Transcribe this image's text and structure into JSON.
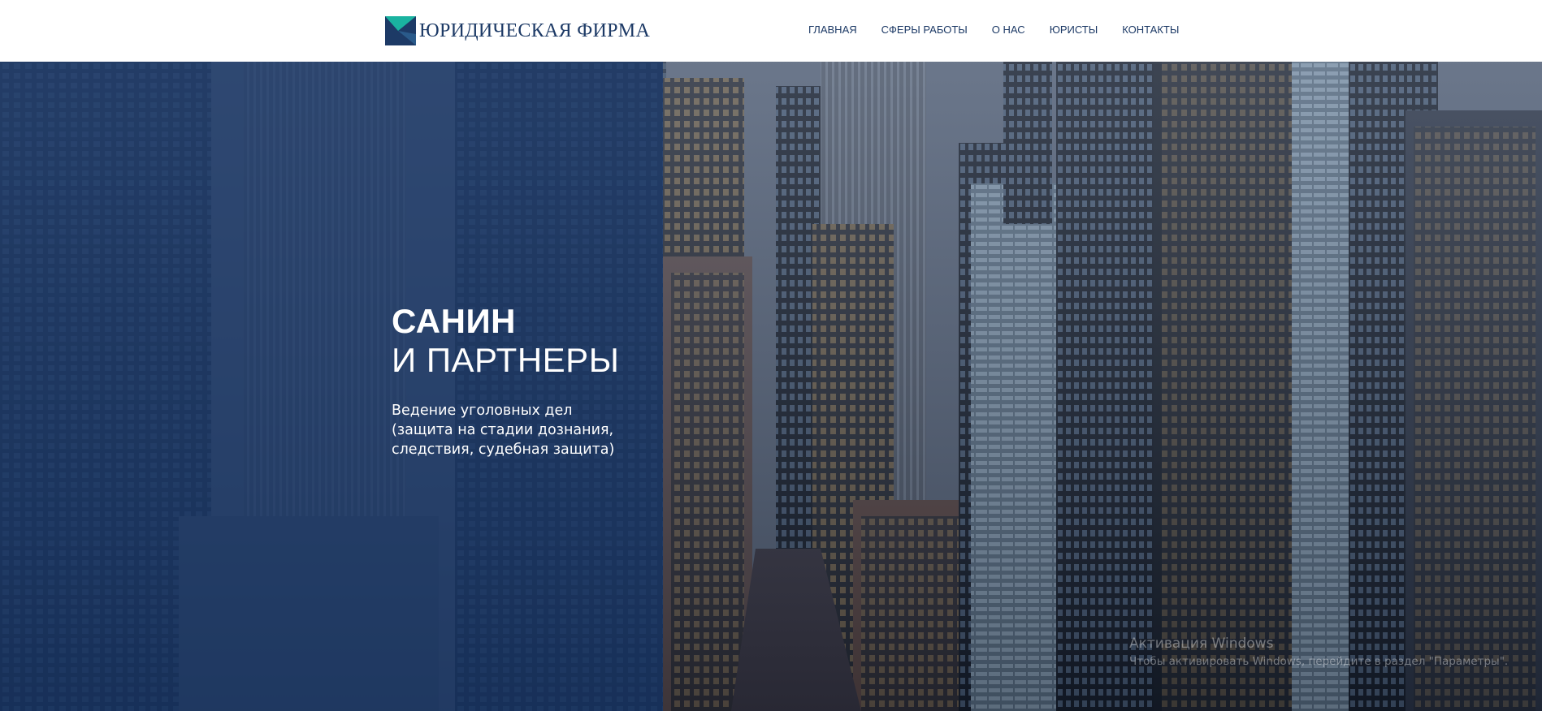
{
  "header": {
    "logo_text": "ЮРИДИЧЕСКАЯ ФИРМА",
    "logo_icon": "firm-logo-icon",
    "nav": [
      {
        "label": "ГЛАВНАЯ"
      },
      {
        "label": "СФЕРЫ РАБОТЫ"
      },
      {
        "label": "О НАС"
      },
      {
        "label": "ЮРИСТЫ"
      },
      {
        "label": "КОНТАКТЫ"
      }
    ]
  },
  "hero": {
    "title_line1": "САНИН",
    "title_line2": "И ПАРТНЕРЫ",
    "subtitle_lines": [
      "Ведение уголовных дел",
      "(защита на стадии дознания,",
      "следствия, судебная защита)"
    ],
    "background_image": "city-skyscrapers-photo"
  },
  "watermark": {
    "title": "Активация Windows",
    "text": "Чтобы активировать Windows, перейдите в раздел \"Параметры\"."
  },
  "colors": {
    "brand_navy": "#1d3a66",
    "brand_teal": "#1ab3a0",
    "overlay": "#173668",
    "header_bg": "#ffffff"
  }
}
